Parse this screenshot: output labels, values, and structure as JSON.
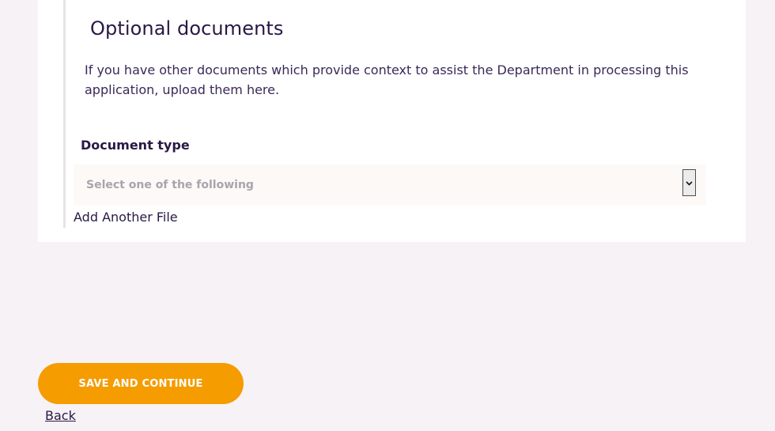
{
  "optional_documents": {
    "title": "Optional documents",
    "description": "If you have other documents which provide context to assist the Department in processing this application, upload them here.",
    "document_type_label": "Document type",
    "select_placeholder": "Select one of the following",
    "add_file_label": "Add Another File"
  },
  "actions": {
    "save_label": "SAVE AND CONTINUE",
    "back_label": "Back"
  },
  "colors": {
    "accent": "#f59c00",
    "text": "#2a1845",
    "page_background": "#f7f2f6"
  },
  "icons": {
    "select_arrow": "chevron-down-icon"
  }
}
